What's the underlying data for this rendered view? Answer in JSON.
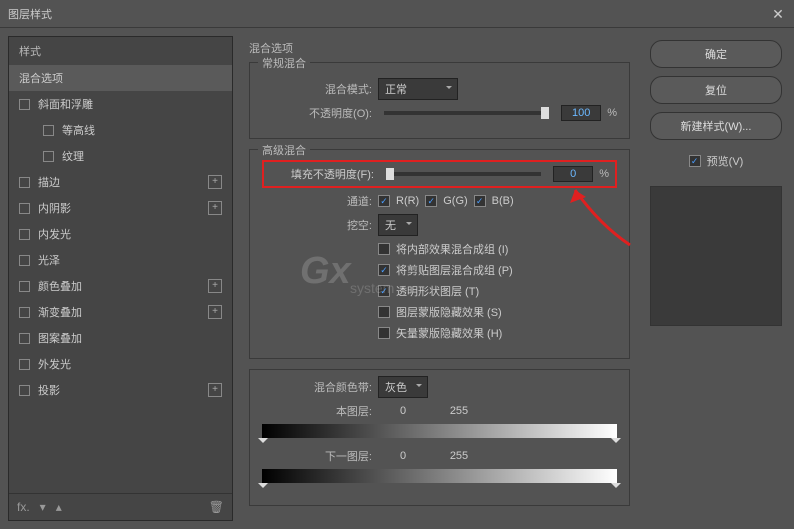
{
  "title": "图层样式",
  "left": {
    "head": "样式",
    "items": [
      {
        "label": "混合选项",
        "sel": true
      },
      {
        "label": "斜面和浮雕",
        "chk": false
      },
      {
        "label": "等高线",
        "chk": false,
        "sub": true
      },
      {
        "label": "纹理",
        "chk": false,
        "sub": true
      },
      {
        "label": "描边",
        "chk": false,
        "plus": true
      },
      {
        "label": "内阴影",
        "chk": false,
        "plus": true
      },
      {
        "label": "内发光",
        "chk": false
      },
      {
        "label": "光泽",
        "chk": false
      },
      {
        "label": "颜色叠加",
        "chk": false,
        "plus": true
      },
      {
        "label": "渐变叠加",
        "chk": false,
        "plus": true
      },
      {
        "label": "图案叠加",
        "chk": false
      },
      {
        "label": "外发光",
        "chk": false
      },
      {
        "label": "投影",
        "chk": false,
        "plus": true
      }
    ]
  },
  "mid": {
    "heading": "混合选项",
    "normal": {
      "title": "常规混合",
      "mode_lbl": "混合模式:",
      "mode_val": "正常",
      "opacity_lbl": "不透明度(O):",
      "opacity_val": "100",
      "pct": "%"
    },
    "adv": {
      "title": "高级混合",
      "fill_lbl": "填充不透明度(F):",
      "fill_val": "0",
      "pct": "%",
      "ch_lbl": "通道:",
      "r": "R(R)",
      "g": "G(G)",
      "b": "B(B)",
      "knock_lbl": "挖空:",
      "knock_val": "无",
      "c1": "将内部效果混合成组 (I)",
      "c2": "将剪贴图层混合成组 (P)",
      "c3": "透明形状图层 (T)",
      "c4": "图层蒙版隐藏效果 (S)",
      "c5": "矢量蒙版隐藏效果 (H)"
    },
    "blend": {
      "lbl": "混合颜色带:",
      "val": "灰色",
      "this_lbl": "本图层:",
      "next_lbl": "下一图层:",
      "v0": "0",
      "v255": "255"
    }
  },
  "right": {
    "ok": "确定",
    "cancel": "复位",
    "new": "新建样式(W)...",
    "preview": "预览(V)"
  }
}
